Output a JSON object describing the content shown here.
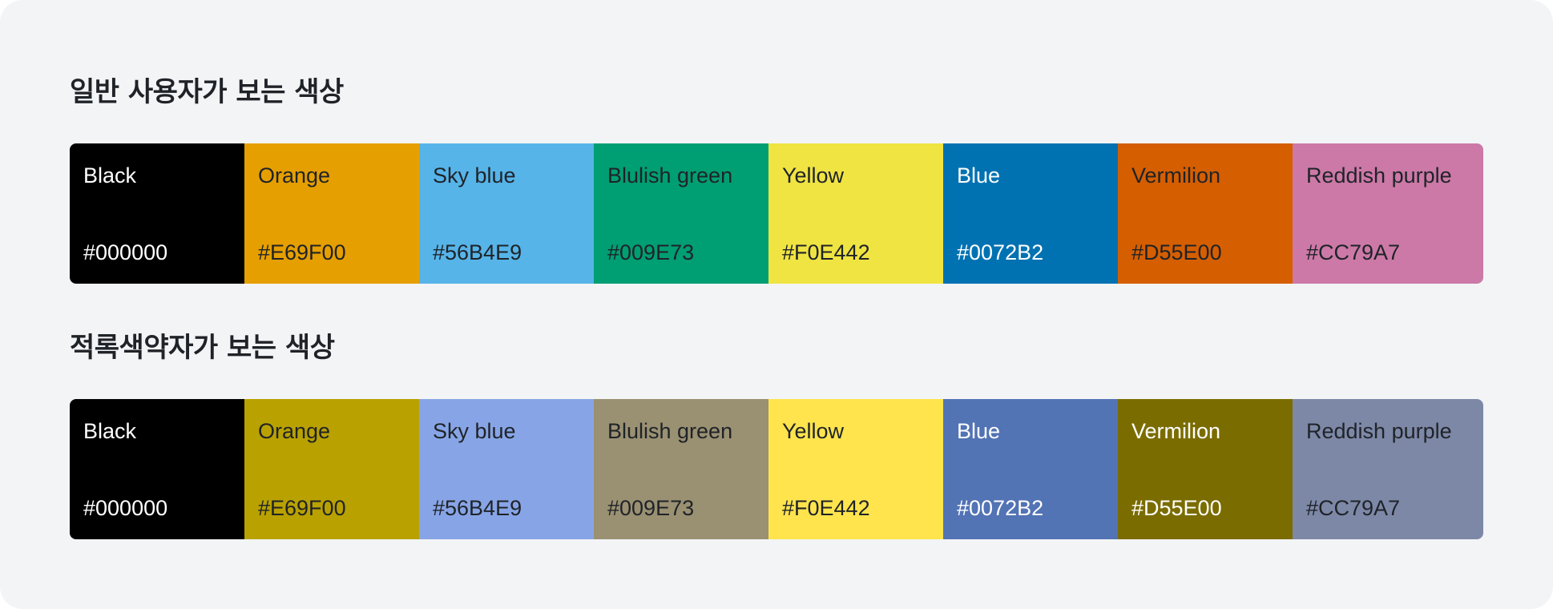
{
  "sections": [
    {
      "title": "일반 사용자가 보는 색상",
      "swatches": [
        {
          "name": "Black",
          "hex": "#000000",
          "fill": "#000000",
          "text_tone": "light"
        },
        {
          "name": "Orange",
          "hex": "#E69F00",
          "fill": "#E69F00",
          "text_tone": "dark"
        },
        {
          "name": "Sky blue",
          "hex": "#56B4E9",
          "fill": "#56B4E9",
          "text_tone": "dark"
        },
        {
          "name": "Blulish green",
          "hex": "#009E73",
          "fill": "#009E73",
          "text_tone": "dark"
        },
        {
          "name": "Yellow",
          "hex": "#F0E442",
          "fill": "#F0E442",
          "text_tone": "dark"
        },
        {
          "name": "Blue",
          "hex": "#0072B2",
          "fill": "#0072B2",
          "text_tone": "light"
        },
        {
          "name": "Vermilion",
          "hex": "#D55E00",
          "fill": "#D55E00",
          "text_tone": "dark"
        },
        {
          "name": "Reddish purple",
          "hex": "#CC79A7",
          "fill": "#CC79A7",
          "text_tone": "dark"
        }
      ]
    },
    {
      "title": "적록색약자가 보는 색상",
      "swatches": [
        {
          "name": "Black",
          "hex": "#000000",
          "fill": "#000000",
          "text_tone": "light"
        },
        {
          "name": "Orange",
          "hex": "#E69F00",
          "fill": "#B9A100",
          "text_tone": "dark"
        },
        {
          "name": "Sky blue",
          "hex": "#56B4E9",
          "fill": "#87A5E6",
          "text_tone": "dark"
        },
        {
          "name": "Blulish green",
          "hex": "#009E73",
          "fill": "#9A9072",
          "text_tone": "dark"
        },
        {
          "name": "Yellow",
          "hex": "#F0E442",
          "fill": "#FFE44D",
          "text_tone": "dark"
        },
        {
          "name": "Blue",
          "hex": "#0072B2",
          "fill": "#5273B4",
          "text_tone": "light"
        },
        {
          "name": "Vermilion",
          "hex": "#D55E00",
          "fill": "#7B6C00",
          "text_tone": "light"
        },
        {
          "name": "Reddish purple",
          "hex": "#CC79A7",
          "fill": "#7D88A7",
          "text_tone": "dark"
        }
      ]
    }
  ]
}
